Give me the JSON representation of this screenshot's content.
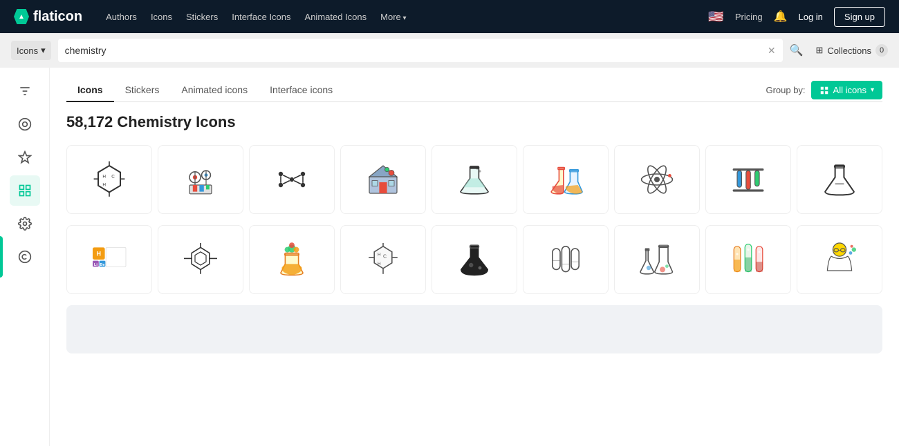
{
  "brand": {
    "name": "flaticon",
    "logo_symbol": "▲"
  },
  "topnav": {
    "links": [
      "Authors",
      "Icons",
      "Stickers",
      "Interface Icons",
      "Animated Icons",
      "More"
    ],
    "pricing": "Pricing",
    "login": "Log in",
    "signup": "Sign up"
  },
  "searchbar": {
    "type_label": "Icons",
    "search_value": "chemistry",
    "collections_label": "Collections",
    "collections_count": "0"
  },
  "sidebar": {
    "items": [
      "⚙",
      "◎",
      "★",
      "⊞",
      "◈",
      "©"
    ]
  },
  "tabs": {
    "items": [
      "Icons",
      "Stickers",
      "Animated icons",
      "Interface icons"
    ],
    "active": "Icons",
    "group_by_label": "Group by:",
    "all_icons_label": "All icons"
  },
  "results": {
    "count": "58,172",
    "subject": "Chemistry Icons"
  }
}
